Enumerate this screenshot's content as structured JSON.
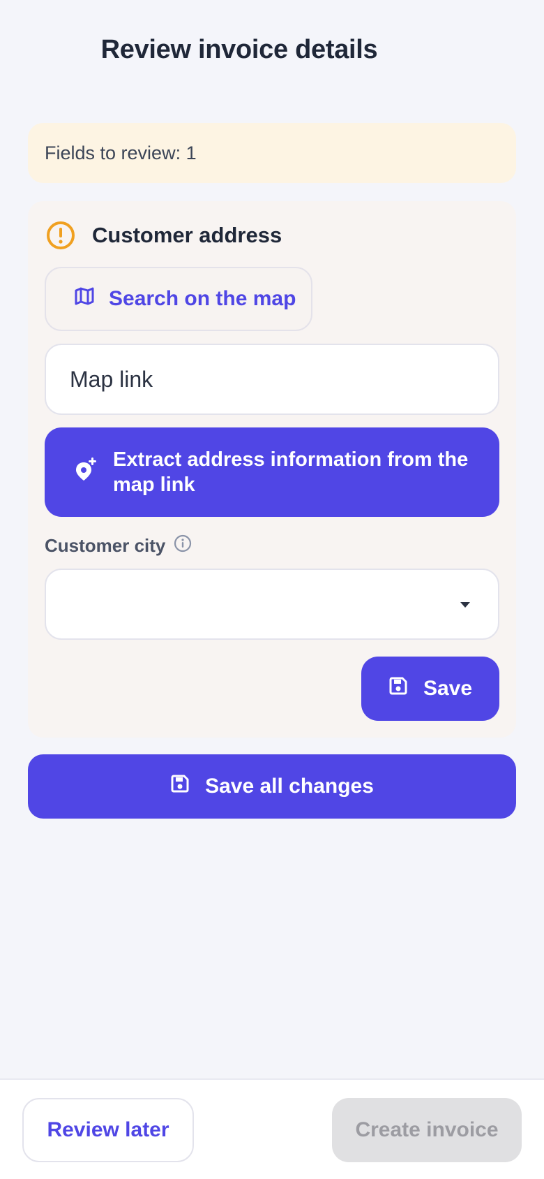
{
  "header": {
    "title": "Review invoice details"
  },
  "notice": {
    "text": "Fields to review: 1"
  },
  "address_card": {
    "title": "Customer address",
    "status_icon": "warning-icon",
    "search_map_label": "Search on the map",
    "map_link": {
      "value": "",
      "placeholder": "Map link"
    },
    "extract_label": "Extract address information from the map link",
    "city": {
      "label": "Customer city",
      "selected": ""
    },
    "save_label": "Save"
  },
  "save_all_label": "Save all changes",
  "footer": {
    "review_later_label": "Review later",
    "create_invoice_label": "Create invoice",
    "create_invoice_disabled": true
  },
  "colors": {
    "accent": "#5046e5",
    "warning": "#f0a020",
    "notice_bg": "#fdf4e3",
    "card_bg": "#f8f4f2",
    "page_bg": "#f4f5fa",
    "disabled_bg": "#e0e0e2"
  }
}
